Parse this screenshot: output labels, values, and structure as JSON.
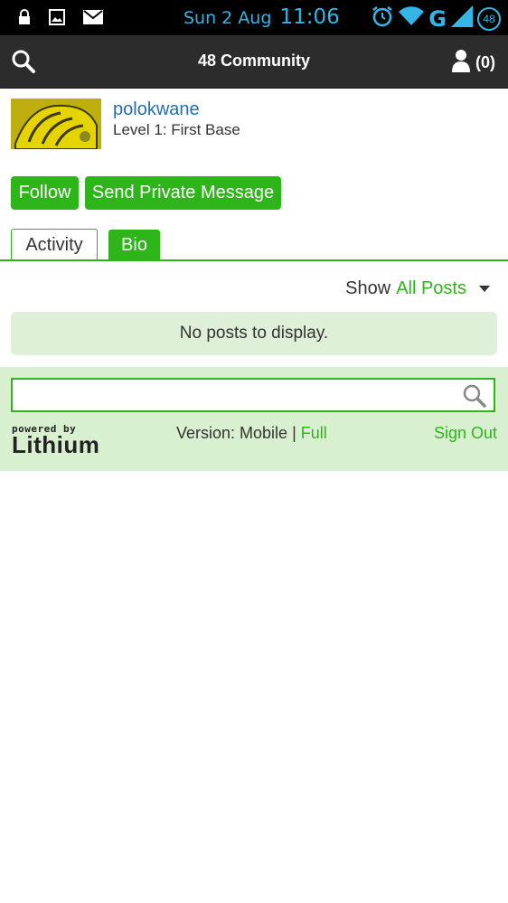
{
  "status_bar": {
    "date": "Sun 2 Aug",
    "time": "11:06",
    "network": "G",
    "battery": "48",
    "icons": [
      "lock-icon",
      "image-icon",
      "mail-icon",
      "alarm-icon",
      "wifi-icon",
      "signal-icon"
    ],
    "accent_color": "#33b5e5"
  },
  "header": {
    "title": "48 Community",
    "notifications": "(0)"
  },
  "profile": {
    "username": "polokwane",
    "level": "Level 1: First Base"
  },
  "actions": {
    "follow": "Follow",
    "send_message": "Send Private Message"
  },
  "tabs": [
    {
      "label": "Activity",
      "active": true
    },
    {
      "label": "Bio",
      "active": false
    }
  ],
  "filter": {
    "label": "Show",
    "value": "All Posts"
  },
  "empty_message": "No posts to display.",
  "footer": {
    "search_placeholder": "",
    "powered_small": "powered by",
    "powered_brand": "Lithium",
    "version_label": "Version: Mobile |",
    "version_full": "Full",
    "sign_out": "Sign Out"
  },
  "colors": {
    "brand_green": "#2db51a",
    "header_bg": "#2c2c2c",
    "footer_bg": "#d9f0d0",
    "link_blue": "#1f6fb0"
  }
}
